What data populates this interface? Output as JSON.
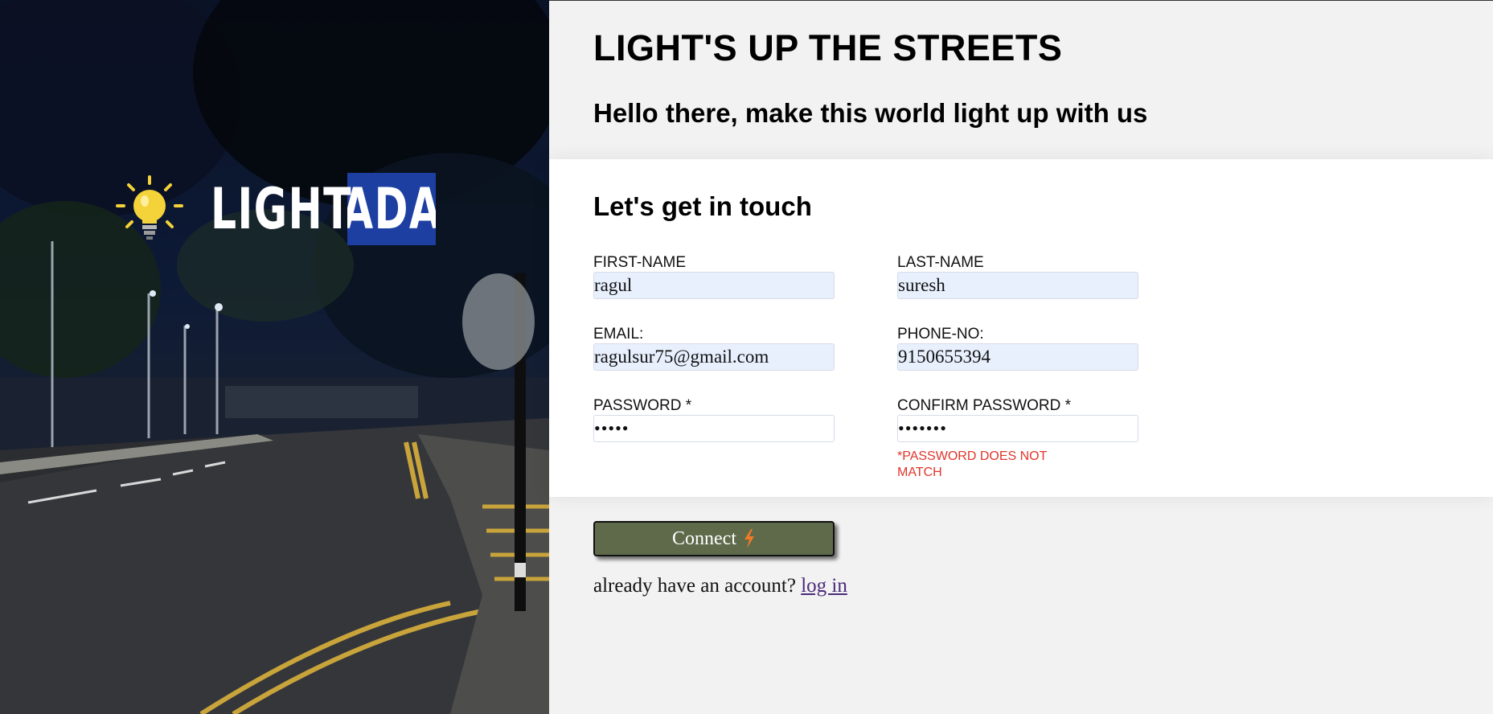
{
  "brand": {
    "logo_word_1": "LIGHT",
    "logo_word_2": "ADA",
    "bulb_icon": "lightbulb-icon",
    "logo_accent": "#1d3fa1"
  },
  "header": {
    "title": "LIGHT'S UP THE STREETS",
    "subtitle": "Hello there, make this world light up with us"
  },
  "form": {
    "heading": "Let's get in touch",
    "first_name": {
      "label": "FIRST-NAME",
      "value": "ragul"
    },
    "last_name": {
      "label": "LAST-NAME",
      "value": "suresh"
    },
    "email": {
      "label": "EMAIL:",
      "value": "ragulsur75@gmail.com"
    },
    "phone": {
      "label": "PHONE-NO:",
      "value": "9150655394"
    },
    "password": {
      "label": "PASSWORD *",
      "value": "•••••"
    },
    "confirm_password": {
      "label": "CONFIRM PASSWORD *",
      "value": "•••••••"
    },
    "error": "*PASSWORD DOES NOT MATCH",
    "error_color": "#e0352b"
  },
  "actions": {
    "connect_label": "Connect",
    "connect_icon": "lightning-bolt-icon",
    "button_color": "#5e6a4a",
    "login_prompt": "already have an account?",
    "login_link": "log in"
  }
}
